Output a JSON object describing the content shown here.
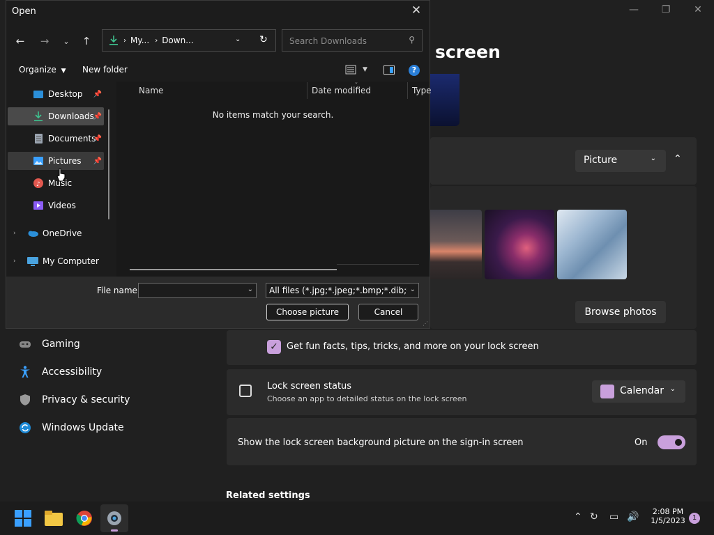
{
  "settings": {
    "page_title": "screen",
    "background_dropdown": "Picture",
    "browse_label": "Browse photos",
    "fun_facts": "Get fun facts, tips, tricks, and more on your lock screen",
    "status_title": "Lock screen status",
    "status_desc": "Choose an app to detailed status on the lock screen",
    "status_dropdown": "Calendar",
    "signin_label": "Show the lock screen background picture on the sign-in screen",
    "signin_state": "On",
    "related": "Related settings",
    "nav": [
      {
        "label": "Gaming",
        "icon": "gamepad-icon"
      },
      {
        "label": "Accessibility",
        "icon": "accessibility-icon"
      },
      {
        "label": "Privacy & security",
        "icon": "shield-icon"
      },
      {
        "label": "Windows Update",
        "icon": "update-icon"
      }
    ],
    "accent": "#c9a0dc"
  },
  "dialog": {
    "title": "Open",
    "address_parts": [
      "My...",
      "Down..."
    ],
    "search_placeholder": "Search Downloads",
    "organize": "Organize",
    "new_folder": "New folder",
    "tree": [
      {
        "label": "Desktop",
        "icon": "desktop-icon",
        "pinned": true
      },
      {
        "label": "Downloads",
        "icon": "download-icon",
        "pinned": true
      },
      {
        "label": "Documents",
        "icon": "document-icon",
        "pinned": true
      },
      {
        "label": "Pictures",
        "icon": "pictures-icon",
        "pinned": true
      },
      {
        "label": "Music",
        "icon": "music-icon",
        "pinned": false
      },
      {
        "label": "Videos",
        "icon": "video-icon",
        "pinned": false
      },
      {
        "label": "OneDrive",
        "icon": "cloud-icon",
        "pinned": false
      },
      {
        "label": "My Computer",
        "icon": "computer-icon",
        "pinned": false
      }
    ],
    "columns": [
      "Name",
      "Date modified",
      "Type"
    ],
    "empty_message": "No items match your search.",
    "file_name_label": "File name:",
    "file_name_value": "",
    "file_type": "All files (*.jpg;*.jpeg;*.bmp;*.dib;*.png",
    "choose_btn": "Choose picture",
    "cancel_btn": "Cancel"
  },
  "taskbar": {
    "time": "2:08 PM",
    "date": "1/5/2023",
    "notification_count": "1"
  }
}
